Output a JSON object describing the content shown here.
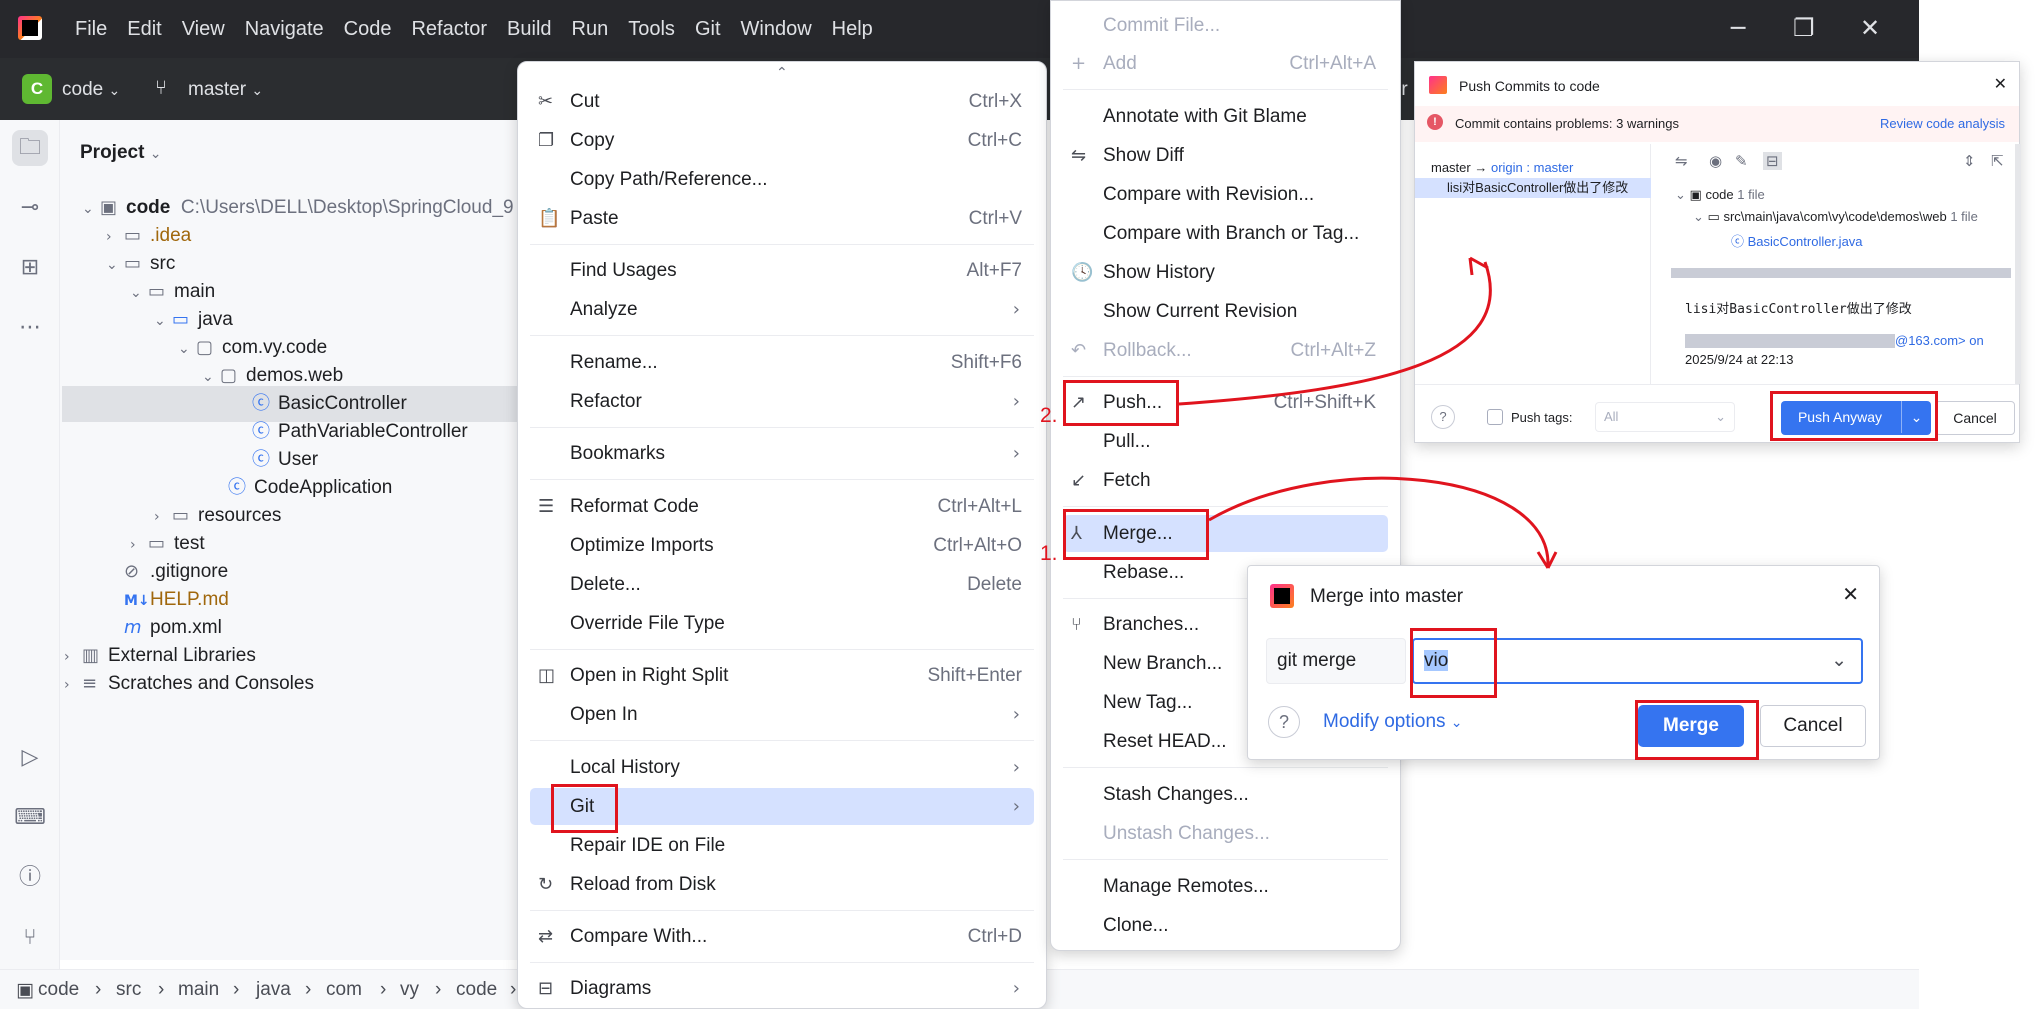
{
  "menubar": [
    "File",
    "Edit",
    "View",
    "Navigate",
    "Code",
    "Refactor",
    "Build",
    "Run",
    "Tools",
    "Git",
    "Window",
    "Help"
  ],
  "toolbar": {
    "project_badge": "C",
    "project_name": "code",
    "branch": "master",
    "partial_text": "rr"
  },
  "project": {
    "header": "Project",
    "root_name": "code",
    "root_path": "C:\\Users\\DELL\\Desktop\\SpringCloud_9",
    "tree": [
      ".idea",
      "src",
      "main",
      "java",
      "com.vy.code",
      "demos.web",
      "BasicController",
      "PathVariableController",
      "User",
      "CodeApplication",
      "resources",
      "test",
      ".gitignore",
      "HELP.md",
      "pom.xml",
      "External Libraries",
      "Scratches and Consoles"
    ]
  },
  "breadcrumb": [
    "code",
    "src",
    "main",
    "java",
    "com",
    "vy",
    "code"
  ],
  "context_menu": {
    "items": [
      {
        "label": "Cut",
        "shortcut": "Ctrl+X",
        "icon": "scissors-icon"
      },
      {
        "label": "Copy",
        "shortcut": "Ctrl+C",
        "icon": "copy-icon"
      },
      {
        "label": "Copy Path/Reference...",
        "shortcut": ""
      },
      {
        "label": "Paste",
        "shortcut": "Ctrl+V",
        "icon": "paste-icon"
      },
      {
        "label": "Find Usages",
        "shortcut": "Alt+F7"
      },
      {
        "label": "Analyze",
        "shortcut": ""
      },
      {
        "label": "Rename...",
        "shortcut": "Shift+F6"
      },
      {
        "label": "Refactor",
        "shortcut": ""
      },
      {
        "label": "Bookmarks",
        "shortcut": ""
      },
      {
        "label": "Reformat Code",
        "shortcut": "Ctrl+Alt+L",
        "icon": "reformat-icon"
      },
      {
        "label": "Optimize Imports",
        "shortcut": "Ctrl+Alt+O"
      },
      {
        "label": "Delete...",
        "shortcut": "Delete"
      },
      {
        "label": "Override File Type",
        "shortcut": ""
      },
      {
        "label": "Open in Right Split",
        "shortcut": "Shift+Enter",
        "icon": "split-icon"
      },
      {
        "label": "Open In",
        "shortcut": ""
      },
      {
        "label": "Local History",
        "shortcut": ""
      },
      {
        "label": "Git",
        "shortcut": ""
      },
      {
        "label": "Repair IDE on File",
        "shortcut": ""
      },
      {
        "label": "Reload from Disk",
        "shortcut": "",
        "icon": "reload-icon"
      },
      {
        "label": "Compare With...",
        "shortcut": "Ctrl+D",
        "icon": "compare-icon"
      },
      {
        "label": "Diagrams",
        "shortcut": "",
        "icon": "diagram-icon"
      }
    ]
  },
  "git_menu": {
    "items": [
      {
        "label": "Commit File...",
        "shortcut": ""
      },
      {
        "label": "Add",
        "shortcut": "Ctrl+Alt+A"
      },
      {
        "label": "Annotate with Git Blame",
        "shortcut": ""
      },
      {
        "label": "Show Diff",
        "shortcut": ""
      },
      {
        "label": "Compare with Revision...",
        "shortcut": ""
      },
      {
        "label": "Compare with Branch or Tag...",
        "shortcut": ""
      },
      {
        "label": "Show History",
        "shortcut": ""
      },
      {
        "label": "Show Current Revision",
        "shortcut": ""
      },
      {
        "label": "Rollback...",
        "shortcut": "Ctrl+Alt+Z"
      },
      {
        "label": "Push...",
        "shortcut": "Ctrl+Shift+K"
      },
      {
        "label": "Pull...",
        "shortcut": ""
      },
      {
        "label": "Fetch",
        "shortcut": ""
      },
      {
        "label": "Merge...",
        "shortcut": ""
      },
      {
        "label": "Rebase...",
        "shortcut": ""
      },
      {
        "label": "Branches...",
        "shortcut": ""
      },
      {
        "label": "New Branch...",
        "shortcut": ""
      },
      {
        "label": "New Tag...",
        "shortcut": ""
      },
      {
        "label": "Reset HEAD...",
        "shortcut": ""
      },
      {
        "label": "Stash Changes...",
        "shortcut": ""
      },
      {
        "label": "Unstash Changes...",
        "shortcut": ""
      },
      {
        "label": "Manage Remotes...",
        "shortcut": ""
      },
      {
        "label": "Clone...",
        "shortcut": ""
      }
    ]
  },
  "annotations": {
    "step1": "1.",
    "step2": "2."
  },
  "push_dialog": {
    "title": "Push Commits to code",
    "warning": "Commit contains problems: 3 warnings",
    "review_link": "Review code analysis",
    "branch_line_local": "master",
    "branch_line_arrow": "→",
    "branch_line_remote": "origin : master",
    "commit_entry": "lisi对BasicController做出了修改",
    "tree_root": "code",
    "tree_root_count": "1 file",
    "tree_path": "src\\main\\java\\com\\vy\\code\\demos\\web",
    "tree_path_count": "1 file",
    "tree_file": "BasicController.java",
    "commit_message": "lisi对BasicController做出了修改",
    "author_email": "@163.com> on",
    "commit_date": "2025/9/24 at 22:13",
    "push_tags_label": "Push tags:",
    "push_tags_value": "All",
    "push_anyway": "Push Anyway",
    "cancel": "Cancel"
  },
  "merge_dialog": {
    "title": "Merge into master",
    "command": "git merge",
    "branch_value": "vio",
    "modify_options": "Modify options",
    "merge": "Merge",
    "cancel": "Cancel"
  },
  "colors": {
    "accent": "#3574f0",
    "annotation": "#e0141e",
    "highlight": "#d5e1ff"
  }
}
